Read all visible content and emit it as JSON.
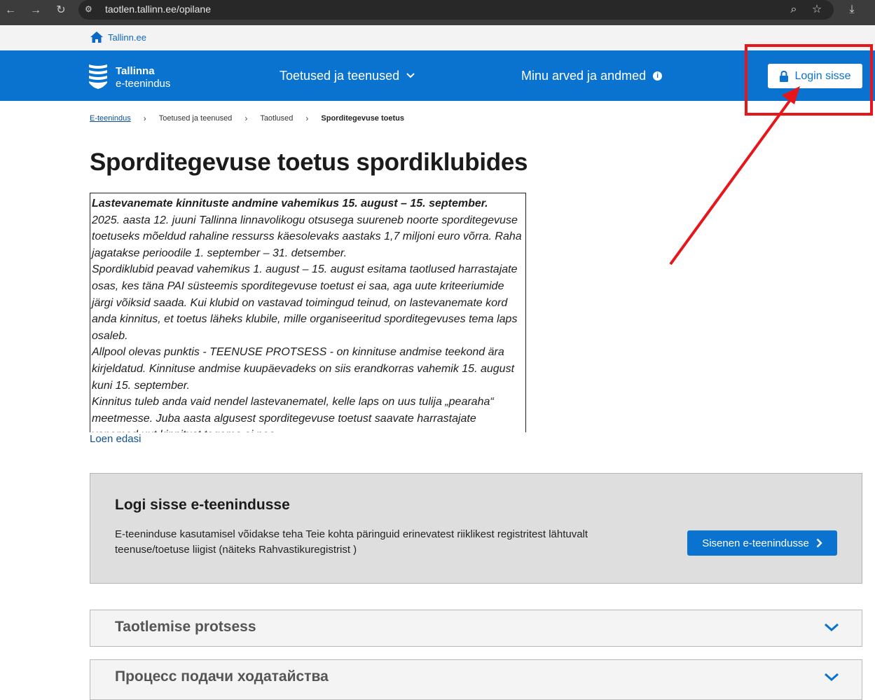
{
  "browser": {
    "url": "taotlen.tallinn.ee/opilane"
  },
  "utility": {
    "home_label": "Tallinn.ee"
  },
  "header": {
    "logo_line1": "Tallinna",
    "logo_line2": "e-teenindus",
    "nav_services": "Toetused ja teenused",
    "nav_account": "Minu arved ja andmed",
    "login_label": "Login sisse",
    "brand_color": "#0a72cf"
  },
  "breadcrumb": {
    "items": [
      "E-teenindus",
      "Toetused ja teenused",
      "Taotlused",
      "Sporditegevuse toetus"
    ]
  },
  "page": {
    "title": "Sporditegevuse toetus spordiklubides",
    "notice_lines": [
      "Lastevanemate kinnituste andmine vahemikus 15. august – 15. september.",
      "2025. aasta 12. juuni Tallinna linnavolikogu otsusega suureneb noorte sporditegevuse toetuseks mõeldud rahaline ressurss käesolevaks aastaks 1,7 miljoni euro võrra. Raha jagatakse perioodile 1. september – 31. detsember.",
      "Spordiklubid peavad vahemikus 1. august – 15. august esitama taotlused harrastajate osas, kes täna PAI süsteemis sporditegevuse toetust ei saa, aga uute kriteeriumide järgi võiksid saada. Kui klubid on vastavad toimingud teinud, on lastevanemate kord anda kinnitus, et toetus läheks klubile, mille organiseeritud sporditegevuses tema laps osaleb.",
      "Allpool olevas punktis - TEENUSE PROTSESS - on kinnituse andmise teekond ära kirjeldatud. Kinnituse andmise kuupäevadeks on siis erandkorras vahemik 15. august kuni 15. september.",
      "Kinnitus tuleb anda vaid nendel lastevanematel, kelle laps on uus tulija „pearaha“ meetmesse. Juba aasta algusest sporditegevuse toetust saavate harrastajate vanemad uut kinnitust tegema ei pea."
    ],
    "read_more": "Loen edasi"
  },
  "login_panel": {
    "title": "Logi sisse e-teenindusse",
    "text": "E-teeninduse kasutamisel võidakse teha Teie kohta päringuid erinevatest riiklikest registritest lähtuvalt teenuse/toetuse liigist (näiteks Rahvastikuregistrist )",
    "button": "Sisenen e-teenindusse"
  },
  "accordions": [
    {
      "title": "Taotlemise protsess"
    },
    {
      "title": "Процесс подачи ходатайства"
    }
  ]
}
